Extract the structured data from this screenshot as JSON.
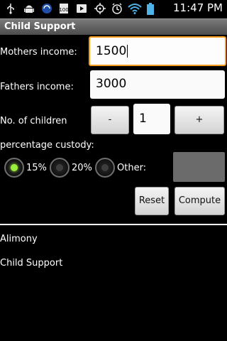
{
  "statusbar": {
    "time": "11:47 PM",
    "icons": [
      "usb-icon",
      "android-debug-icon",
      "sync-icon",
      "battery-100-icon",
      "media-play-icon",
      "gps-icon",
      "alarm-icon",
      "wifi-icon",
      "battery-icon"
    ]
  },
  "titlebar": {
    "title": "Child Support"
  },
  "form": {
    "mothers_income_label": "Mothers income:",
    "mothers_income_value": "1500",
    "fathers_income_label": "Fathers income:",
    "fathers_income_value": "3000",
    "children_label": "No. of children",
    "decrement_label": "-",
    "children_value": "1",
    "increment_label": "+",
    "custody_label": "percentage custody:",
    "custody_options": [
      {
        "label": "15%",
        "checked": true
      },
      {
        "label": "20%",
        "checked": false
      },
      {
        "label": "Other:",
        "checked": false
      }
    ],
    "reset_label": "Reset",
    "compute_label": "Compute"
  },
  "results": {
    "alimony_label": "Alimony",
    "child_support_label": "Child Support"
  },
  "colors": {
    "focus": "#f39c1f",
    "radio_checked": "#9aef3a"
  }
}
